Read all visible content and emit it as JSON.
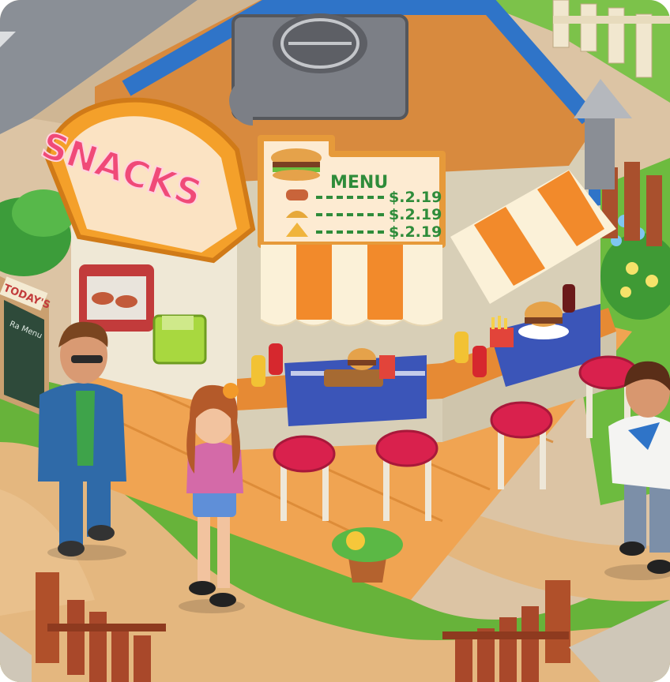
{
  "scene": {
    "stand_sign": "SNACKS",
    "menu": {
      "title": "MENU",
      "items": [
        {
          "price": "$.2.19",
          "icon": "hotdog-icon"
        },
        {
          "price": "$.2.19",
          "icon": "taco-icon"
        },
        {
          "price": "$.2.19",
          "icon": "nachos-icon"
        }
      ]
    },
    "chalkboard_title": "TODAY'S",
    "chalkboard_subtitle": "Ra Menu",
    "characters": [
      "man-in-blue-suit",
      "girl-in-pink-shirt",
      "chef"
    ],
    "colors": {
      "grass": "#67b33a",
      "path": "#e4b77f",
      "deck": "#f0a452",
      "roof_trim": "#2f74c8",
      "sign_pink": "#f04a78",
      "awning_orange": "#f28a2b",
      "awning_cream": "#fbf1d8",
      "stool_seat": "#d9214d",
      "tablecloth": "#3b55b8"
    }
  }
}
